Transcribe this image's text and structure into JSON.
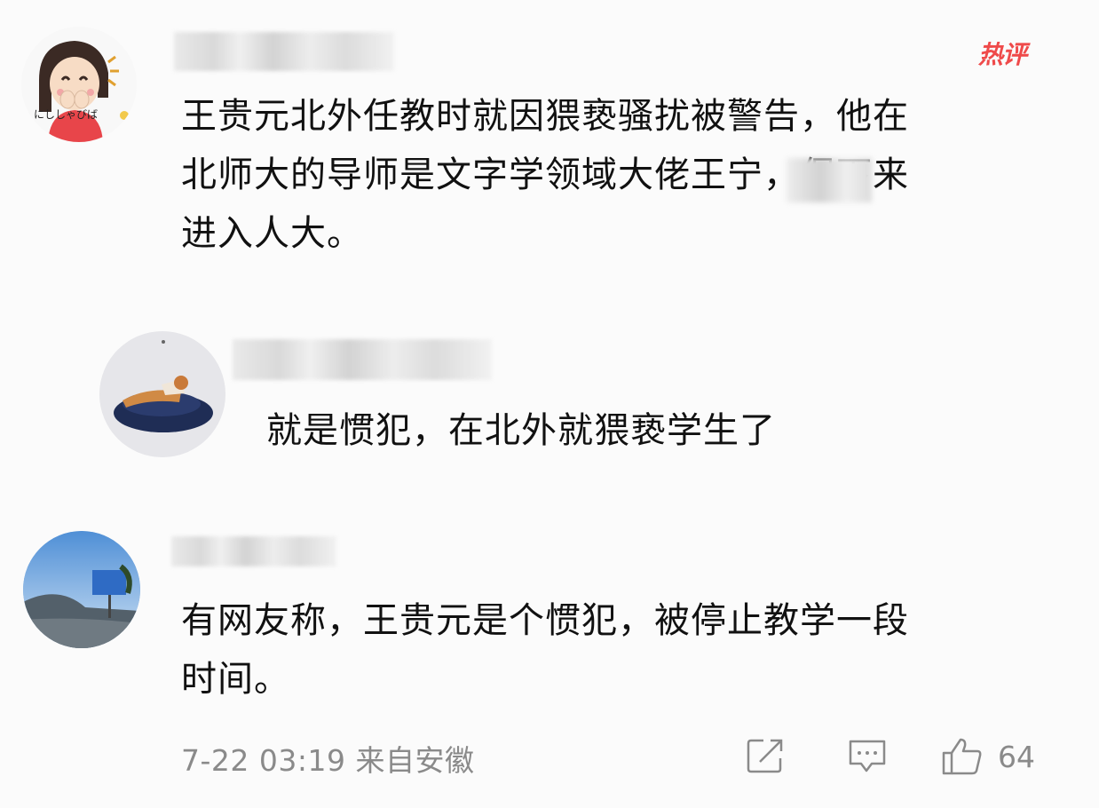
{
  "comments": [
    {
      "tag": "热评",
      "text": "王贵元北外任教时就因猥亵骚扰被警告，他在\n北师大的导师是文字学领域大佬王宁，保下来\n进入人大。"
    },
    {
      "text": "就是惯犯，在北外就猥亵学生了"
    },
    {
      "text": "有网友称，王贵元是个惯犯，被停止教学一段\n时间。"
    }
  ],
  "footer": {
    "meta": "7-22 03:19 来自安徽",
    "like_count": "64"
  },
  "avatar1_caption": "にししゃびば",
  "icons": [
    "share-icon",
    "comment-icon",
    "like-icon"
  ],
  "colors": {
    "hot": "#ef4a4a",
    "meta": "#8a8a8a",
    "text": "#111111"
  }
}
